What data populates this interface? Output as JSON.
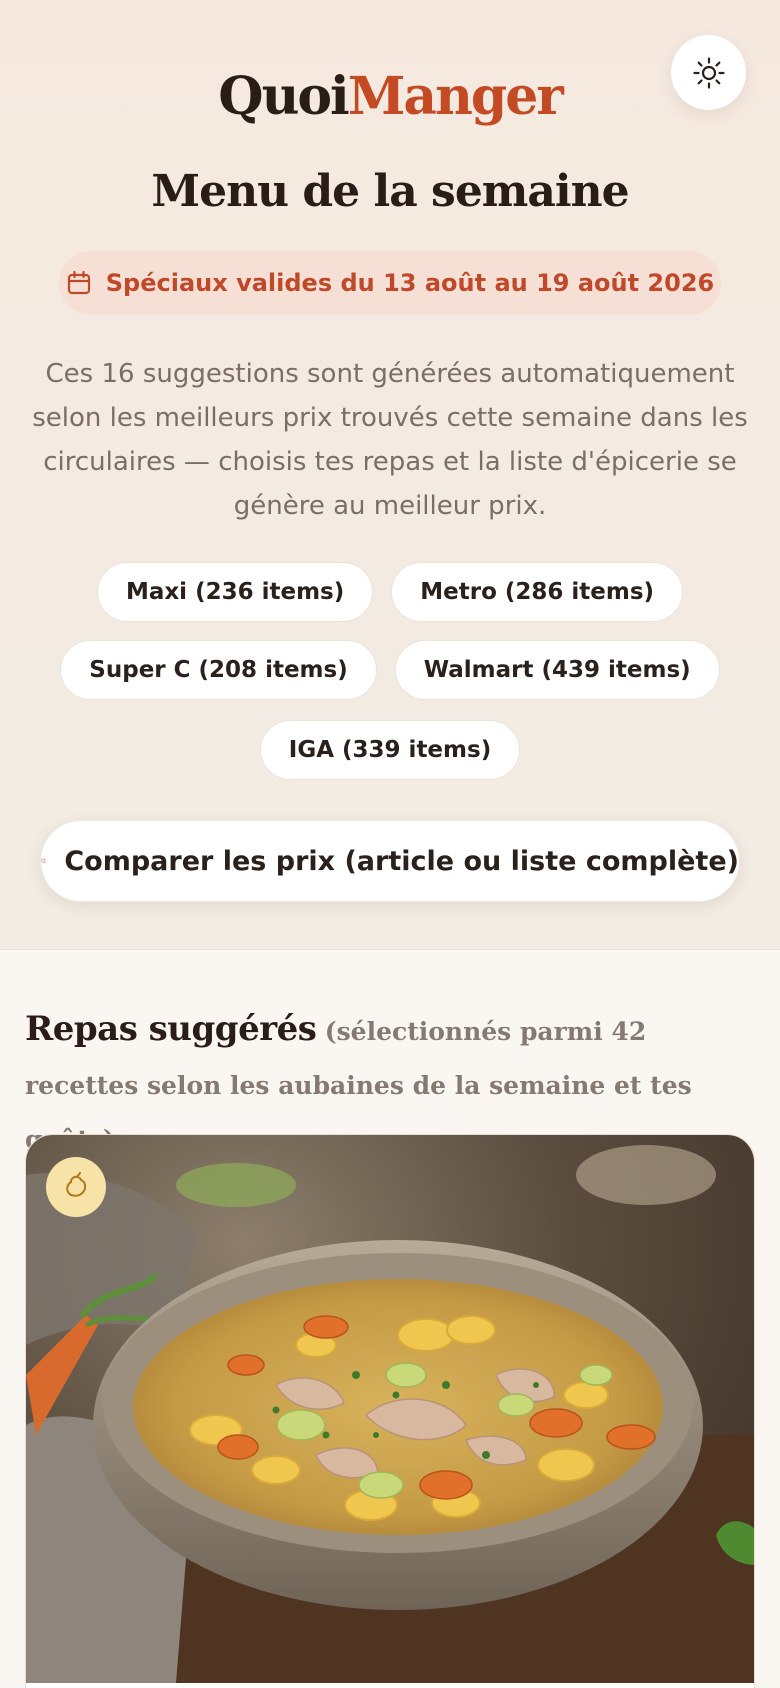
{
  "header": {
    "logo_part1": "Quoi",
    "logo_part2": "Manger",
    "theme_toggle_icon": "sun-icon"
  },
  "page": {
    "title": "Menu de la semaine",
    "date_range": "Spéciaux valides du 13 août au 19 août 2026",
    "date_icon": "calendar-icon",
    "intro": "Ces 16 suggestions sont générées automatiquement selon les meilleurs prix trouvés cette semaine dans les circulaires — choisis tes repas et la liste d'épicerie se génère au meilleur prix."
  },
  "stores": [
    "Maxi (236 items)",
    "Metro (286 items)",
    "Super C (208 items)",
    "Walmart (439 items)",
    "IGA (339 items)"
  ],
  "compare": {
    "label": "Comparer les prix (article ou liste complète)",
    "icon": "search-icon"
  },
  "section": {
    "title": "Repas suggérés",
    "subtitle": "(sélectionnés parmi 42 recettes selon les aubaines de la semaine et tes goûts)"
  },
  "recipe_card": {
    "badge_icon": "chicken-leg-icon",
    "image": "bowl-of-chicken-noodle-soup"
  },
  "colors": {
    "accent": "#c44a24",
    "pill_bg": "#f6e0d6",
    "badge_bg": "#f7e3a8",
    "background": "#faf6f1"
  }
}
